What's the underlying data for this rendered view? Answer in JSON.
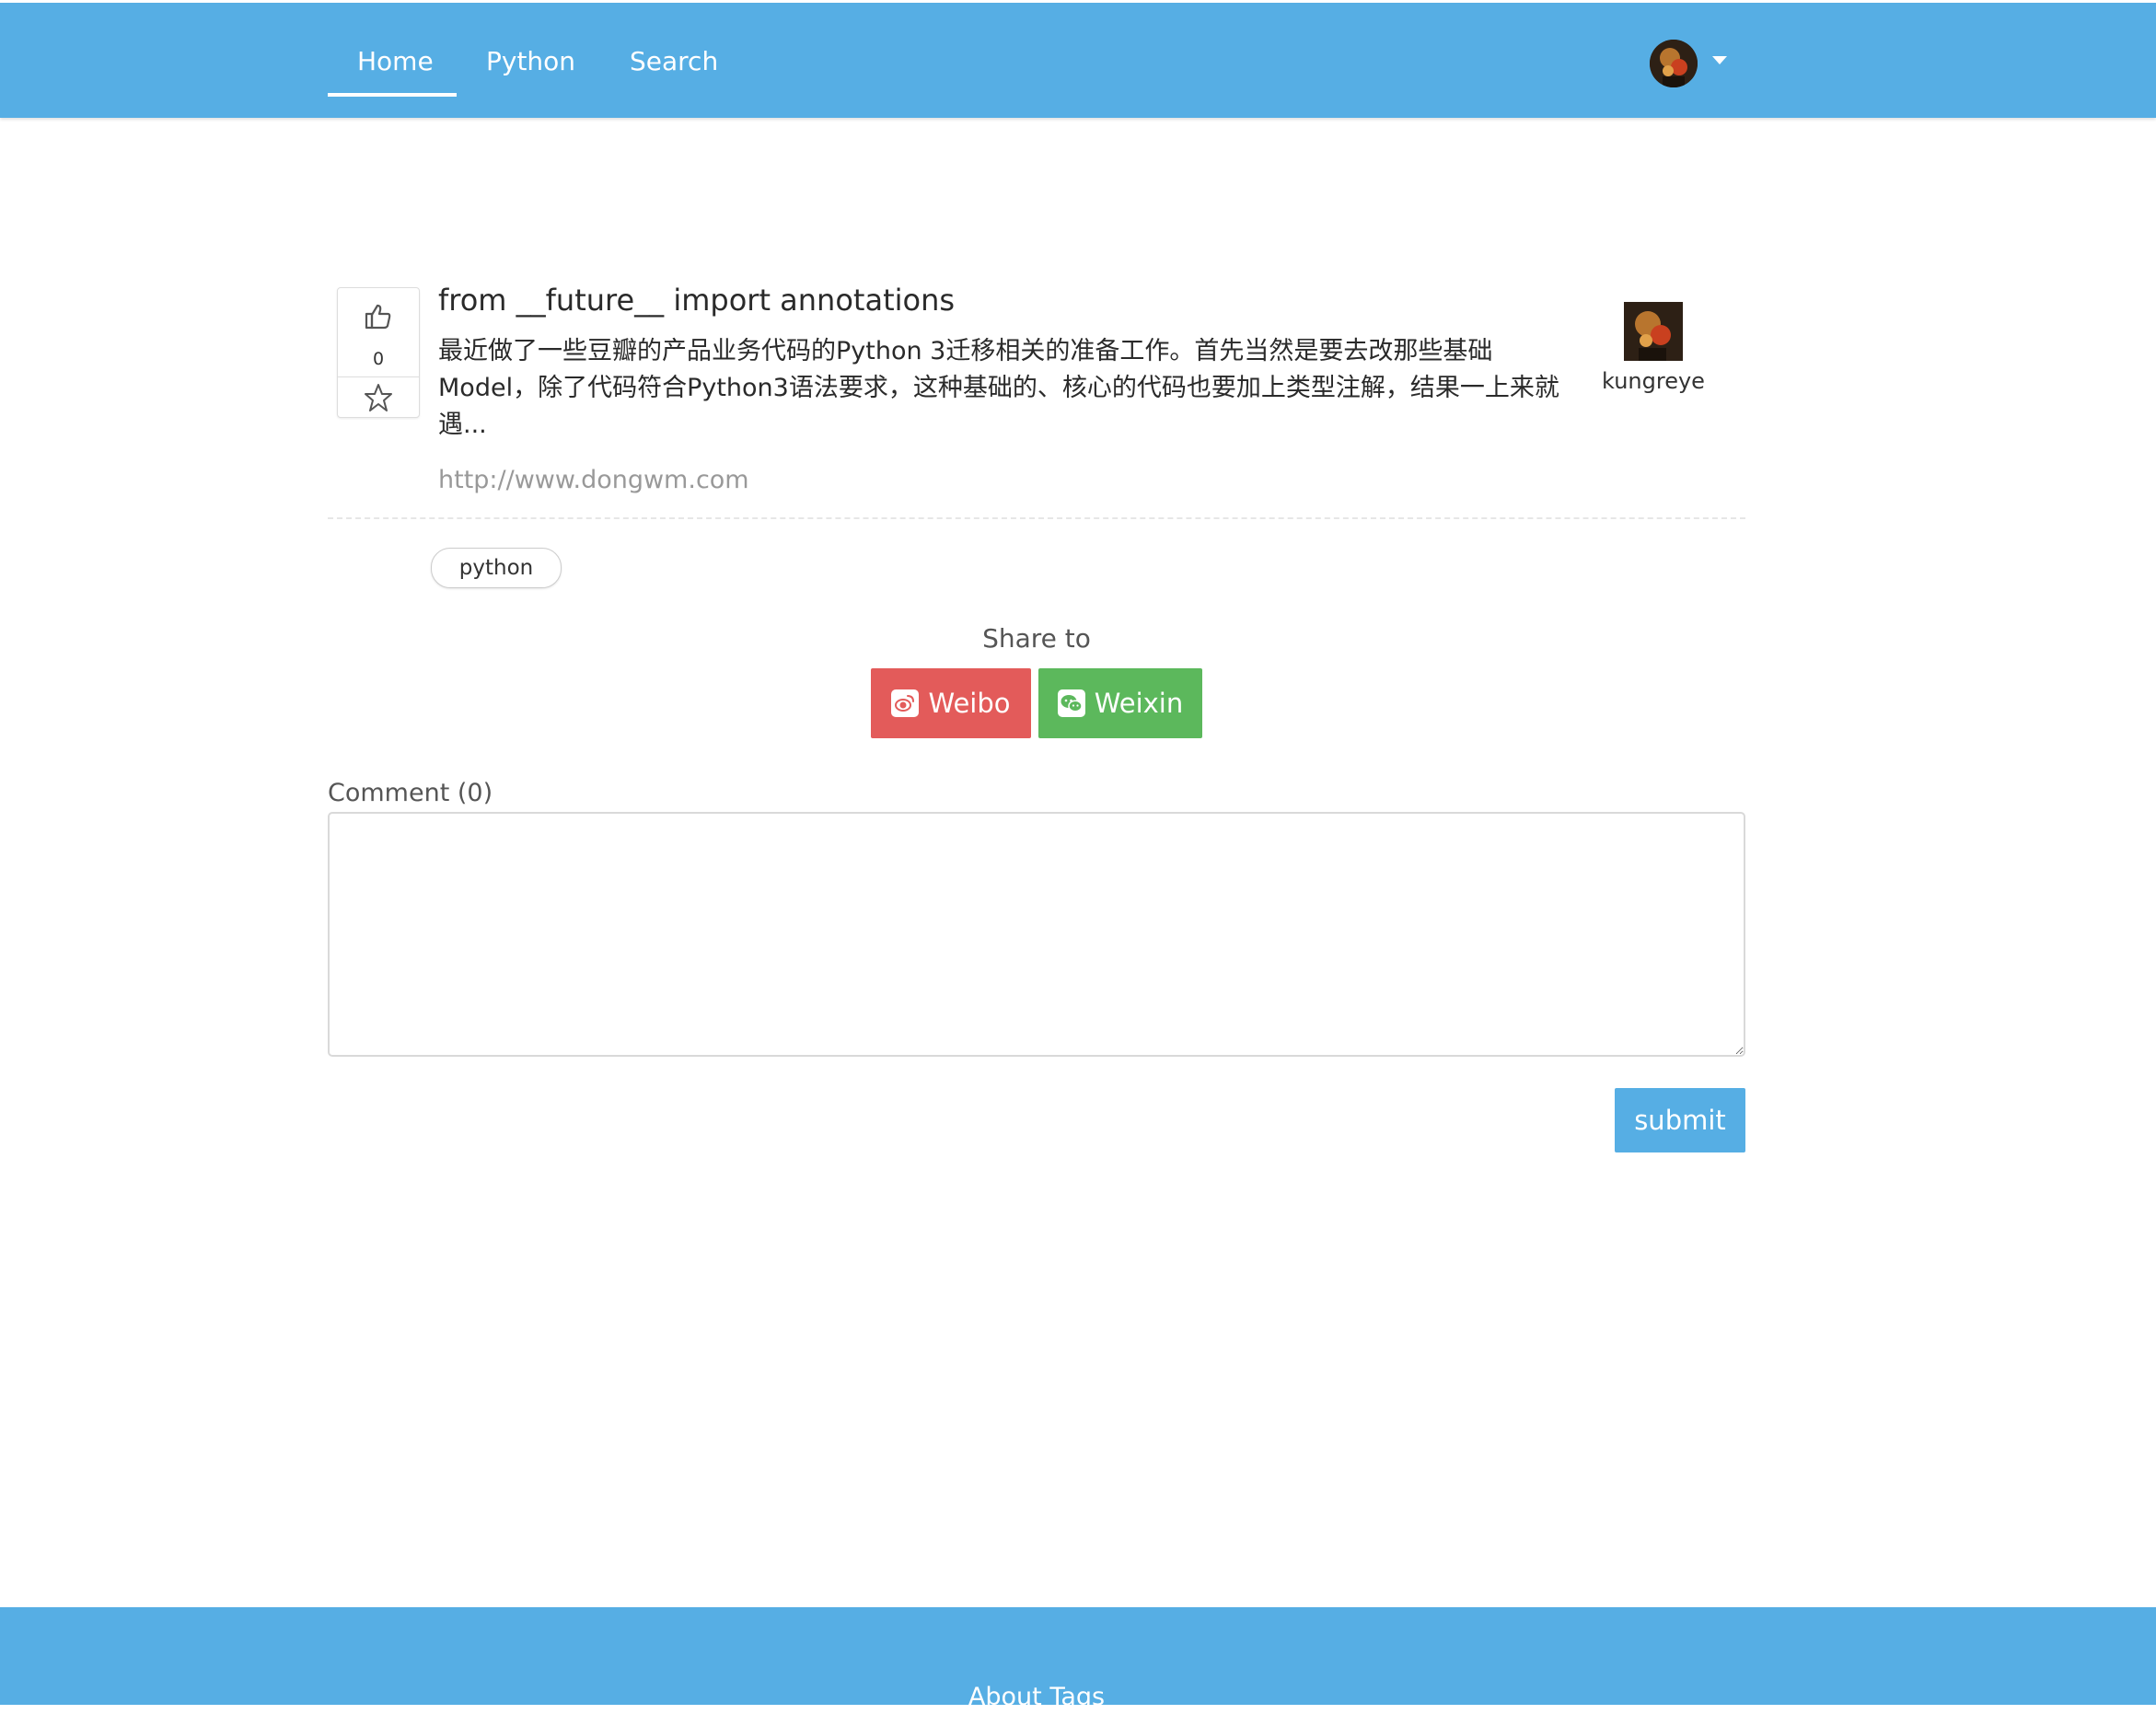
{
  "nav": {
    "items": [
      {
        "label": "Home",
        "active": true
      },
      {
        "label": "Python",
        "active": false
      },
      {
        "label": "Search",
        "active": false
      }
    ],
    "user_avatar_icon": "user-avatar-portrait",
    "menu_caret_icon": "caret-down-icon"
  },
  "post": {
    "title": "from __future__ import annotations",
    "summary": "最近做了一些豆瓣的产品业务代码的Python 3迁移相关的准备工作。首先当然是要去改那些基础Model，除了代码符合Python3语法要求，这种基础的、核心的代码也要加上类型注解，结果一上来就遇...",
    "url": "http://www.dongwm.com",
    "votes": "0",
    "vote_icon": "thumbs-up-icon",
    "favorite_icon": "star-icon",
    "author": "kungreye"
  },
  "tags": [
    "python"
  ],
  "share": {
    "label": "Share to",
    "weibo": "Weibo",
    "weixin": "Weixin",
    "weibo_color": "#e35b5a",
    "weixin_color": "#5cb85c"
  },
  "comment": {
    "label": "Comment (0)",
    "value": "",
    "submit_label": "submit"
  },
  "footer": {
    "about": "About",
    "tags": "Tags"
  },
  "colors": {
    "primary": "#56aee4"
  }
}
